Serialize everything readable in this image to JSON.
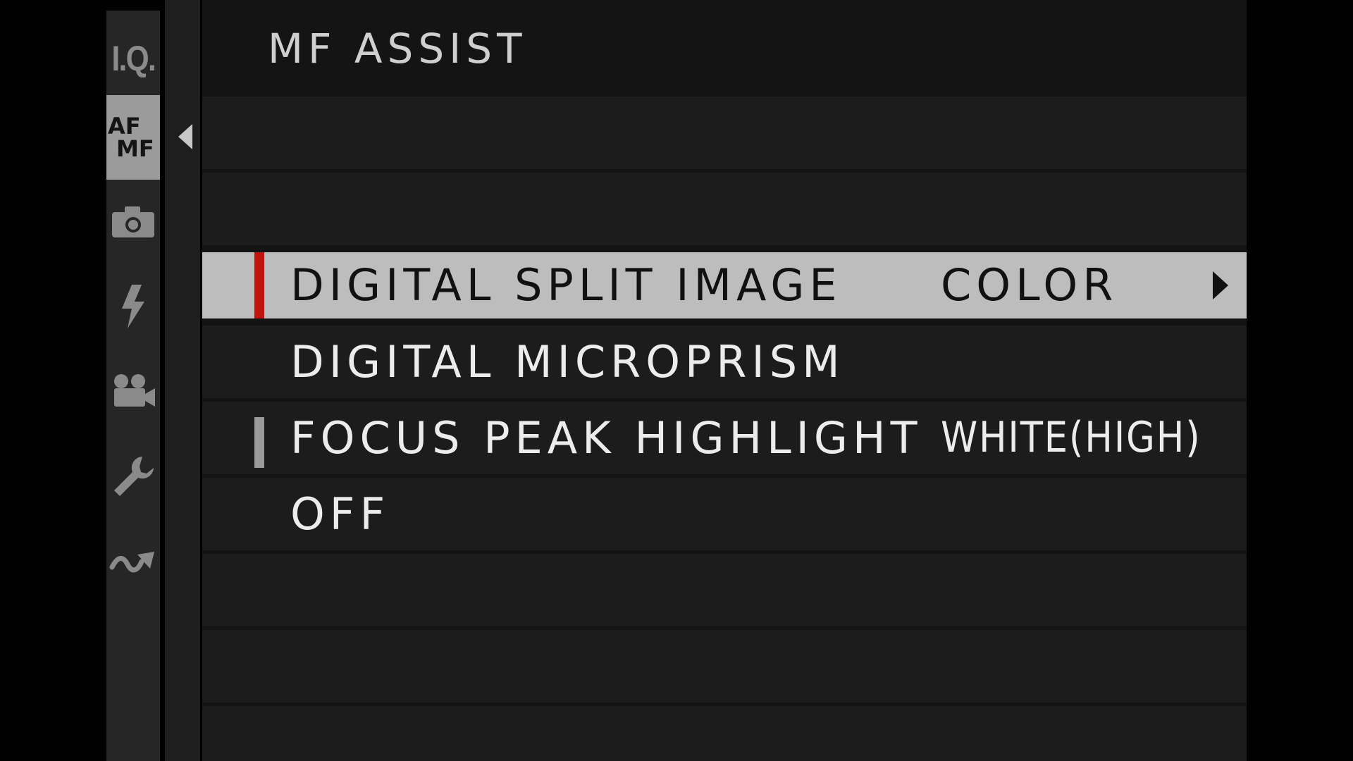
{
  "colors": {
    "selected_row": "#bdbdbd",
    "selected_marker": "#c0140e",
    "current_marker": "#9a9a9a",
    "active_tab": "#9b9b9b"
  },
  "sidebar": {
    "tabs": [
      {
        "name": "image-quality-tab",
        "label": "I.Q.",
        "active": false
      },
      {
        "name": "af-mf-tab",
        "label_top": "AF",
        "label_bottom": "MF",
        "active": true
      },
      {
        "name": "shooting-tab",
        "icon": "camera-icon",
        "active": false
      },
      {
        "name": "flash-tab",
        "icon": "flash-icon",
        "active": false
      },
      {
        "name": "movie-tab",
        "icon": "movie-camera-icon",
        "active": false
      },
      {
        "name": "setup-tab",
        "icon": "wrench-icon",
        "active": false
      },
      {
        "name": "connection-tab",
        "icon": "wave-arrow-icon",
        "active": false
      }
    ]
  },
  "menu": {
    "title": "MF ASSIST",
    "back_icon": "triangle-left-icon",
    "options": [
      {
        "label": "DIGITAL SPLIT IMAGE",
        "value": "COLOR",
        "selected": true,
        "has_submenu": true
      },
      {
        "label": "DIGITAL MICROPRISM",
        "value": "",
        "selected": false
      },
      {
        "label": "FOCUS PEAK HIGHLIGHT",
        "value": "WHITE(HIGH)",
        "selected": false,
        "current": true
      },
      {
        "label": "OFF",
        "value": "",
        "selected": false
      }
    ]
  }
}
